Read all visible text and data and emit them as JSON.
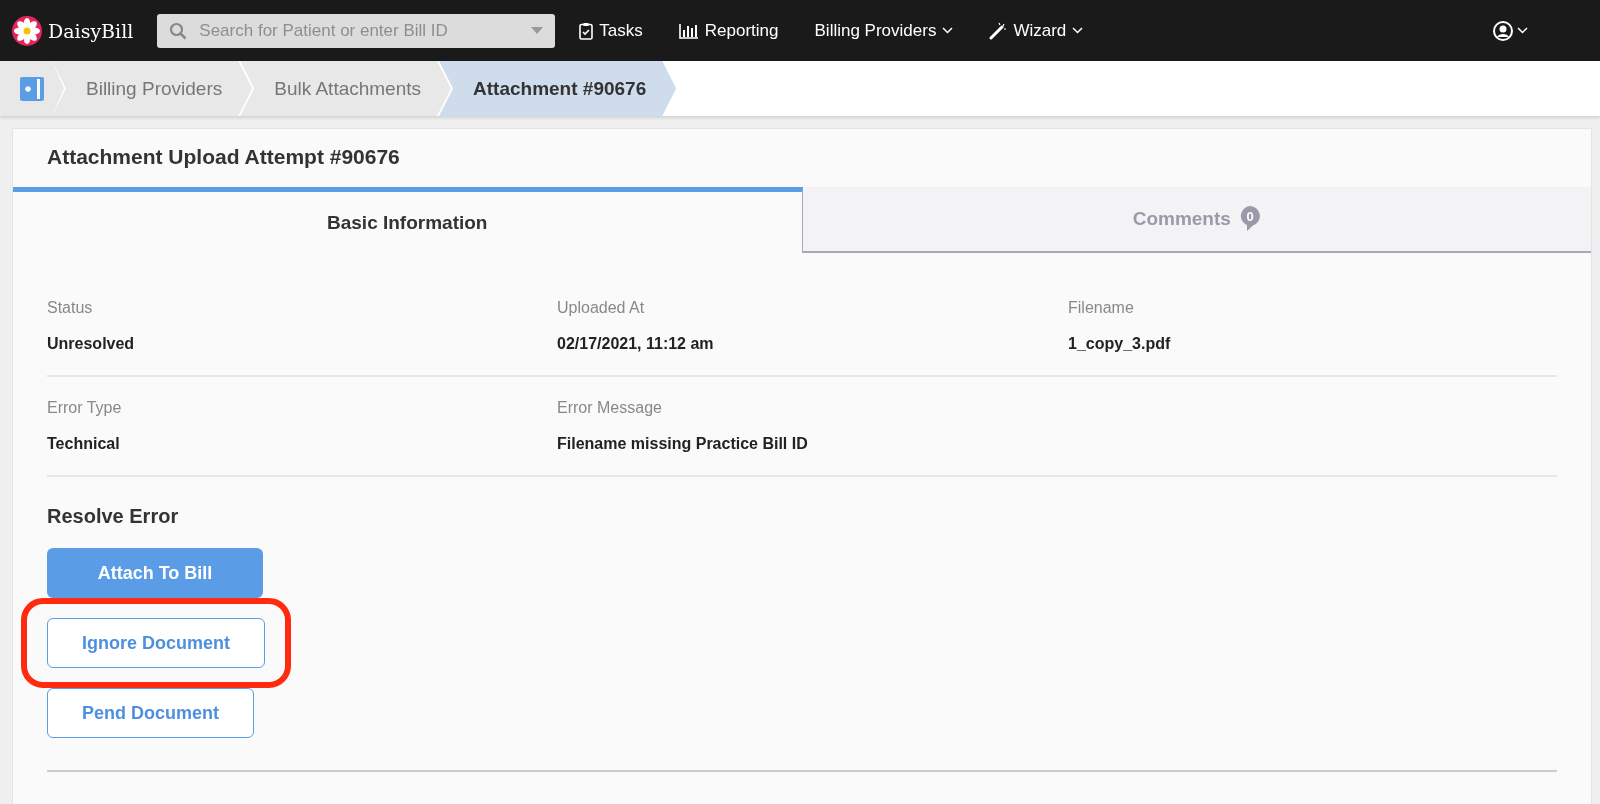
{
  "navbar": {
    "logo": "DaisyBill",
    "search": {
      "placeholder": "Search for Patient or enter Bill ID"
    },
    "items": [
      {
        "label": "Tasks",
        "kind": "tasks",
        "menu": false
      },
      {
        "label": "Reporting",
        "kind": "reporting",
        "menu": false
      },
      {
        "label": "Billing Providers",
        "kind": "plain",
        "menu": true
      },
      {
        "label": "Wizard",
        "kind": "wizard",
        "menu": true
      }
    ]
  },
  "breadcrumbs": [
    {
      "label": "Billing Providers",
      "selected": false
    },
    {
      "label": "Bulk Attachments",
      "selected": false
    },
    {
      "label": "Attachment #90676",
      "selected": true
    }
  ],
  "card": {
    "title": "Attachment Upload Attempt #90676",
    "tabs": [
      {
        "label": "Basic Information",
        "selected": true
      },
      {
        "label": "Comments",
        "badge": "0",
        "selected": false
      }
    ],
    "field_rows": [
      [
        {
          "label": "Status",
          "value": "Unresolved"
        },
        {
          "label": "Uploaded At",
          "value": "02/17/2021, 11:12 am"
        },
        {
          "label": "Filename",
          "value": "1_copy_3.pdf"
        }
      ],
      [
        {
          "label": "Error Type",
          "value": "Technical"
        },
        {
          "label": "Error Message",
          "value": "Filename missing Practice Bill ID"
        }
      ]
    ],
    "section_title": "Resolve Error",
    "buttons": [
      {
        "label": "Attach To Bill",
        "kind": "primary",
        "highlighted": false
      },
      {
        "label": "Ignore Document",
        "kind": "outline",
        "highlighted": true
      },
      {
        "label": "Pend Document",
        "kind": "outline",
        "highlighted": false
      }
    ]
  }
}
